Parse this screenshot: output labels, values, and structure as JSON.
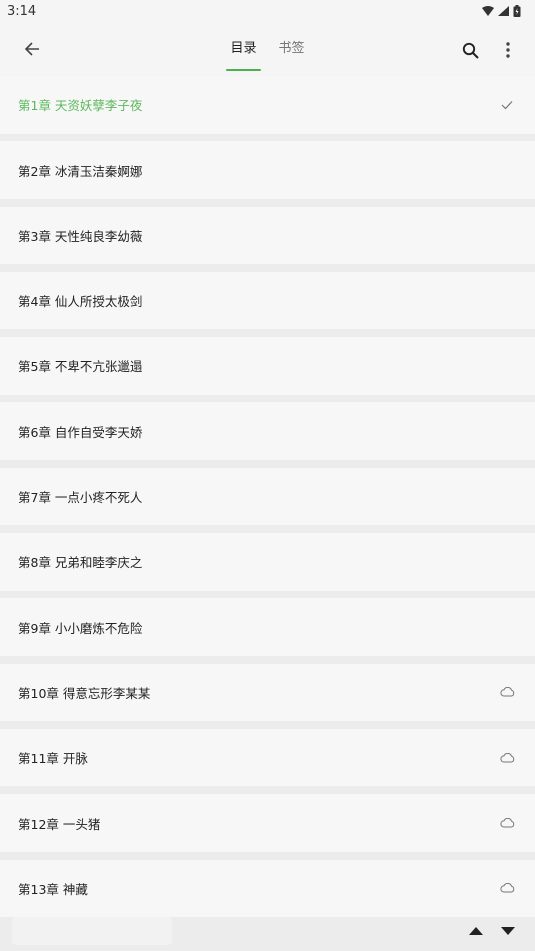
{
  "status_bar": {
    "time": "3:14"
  },
  "toolbar": {
    "tabs": [
      {
        "label": "目录",
        "active": true
      },
      {
        "label": "书签",
        "active": false
      }
    ]
  },
  "chapters": [
    {
      "title": "第1章 天资妖孽李子夜",
      "status": "current"
    },
    {
      "title": "第2章 冰清玉洁秦婀娜",
      "status": "none"
    },
    {
      "title": "第3章 天性纯良李幼薇",
      "status": "none"
    },
    {
      "title": "第4章 仙人所授太极剑",
      "status": "none"
    },
    {
      "title": "第5章 不卑不亢张邋遢",
      "status": "none"
    },
    {
      "title": "第6章 自作自受李天娇",
      "status": "none"
    },
    {
      "title": "第7章 一点小疼不死人",
      "status": "none"
    },
    {
      "title": "第8章 兄弟和睦李庆之",
      "status": "none"
    },
    {
      "title": "第9章 小小磨炼不危险",
      "status": "none"
    },
    {
      "title": "第10章 得意忘形李某某",
      "status": "cloud"
    },
    {
      "title": "第11章 开脉",
      "status": "cloud"
    },
    {
      "title": "第12章 一头猪",
      "status": "cloud"
    },
    {
      "title": "第13章 神藏",
      "status": "cloud"
    }
  ],
  "colors": {
    "accent": "#4caf50",
    "current_text": "#5cb85c"
  }
}
